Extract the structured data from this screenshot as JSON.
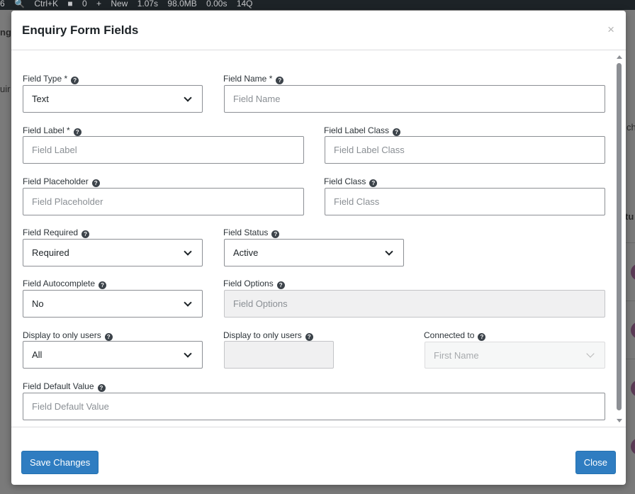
{
  "admin_bar": {
    "items": [
      "6",
      "Ctrl+K",
      "0",
      "New",
      "1.07s",
      "98.0MB",
      "0.00s",
      "14Q"
    ]
  },
  "background": {
    "fragments": [
      "ng",
      "uir",
      "ch",
      "tu"
    ]
  },
  "modal": {
    "title": "Enquiry Form Fields",
    "close_symbol": "×",
    "help_symbol": "?",
    "fields": {
      "field_type": {
        "label": "Field Type *",
        "value": "Text"
      },
      "field_name": {
        "label": "Field Name *",
        "placeholder": "Field Name"
      },
      "field_label": {
        "label": "Field Label *",
        "placeholder": "Field Label"
      },
      "field_label_class": {
        "label": "Field Label Class",
        "placeholder": "Field Label Class"
      },
      "field_placeholder": {
        "label": "Field Placeholder",
        "placeholder": "Field Placeholder"
      },
      "field_class": {
        "label": "Field Class",
        "placeholder": "Field Class"
      },
      "field_required": {
        "label": "Field Required",
        "value": "Required"
      },
      "field_status": {
        "label": "Field Status",
        "value": "Active"
      },
      "field_autocomplete": {
        "label": "Field Autocomplete",
        "value": "No"
      },
      "field_options": {
        "label": "Field Options",
        "placeholder": "Field Options"
      },
      "display_users_1": {
        "label": "Display to only users",
        "value": "All"
      },
      "display_users_2": {
        "label": "Display to only users"
      },
      "connected_to": {
        "label": "Connected to",
        "value": "First Name"
      },
      "field_default_value": {
        "label": "Field Default Value",
        "placeholder": "Field Default Value"
      }
    },
    "footer": {
      "save_label": "Save Changes",
      "close_label": "Close"
    },
    "colors": {
      "primary_button": "#2f7dc1",
      "overlay": "#7a7a7a"
    }
  }
}
